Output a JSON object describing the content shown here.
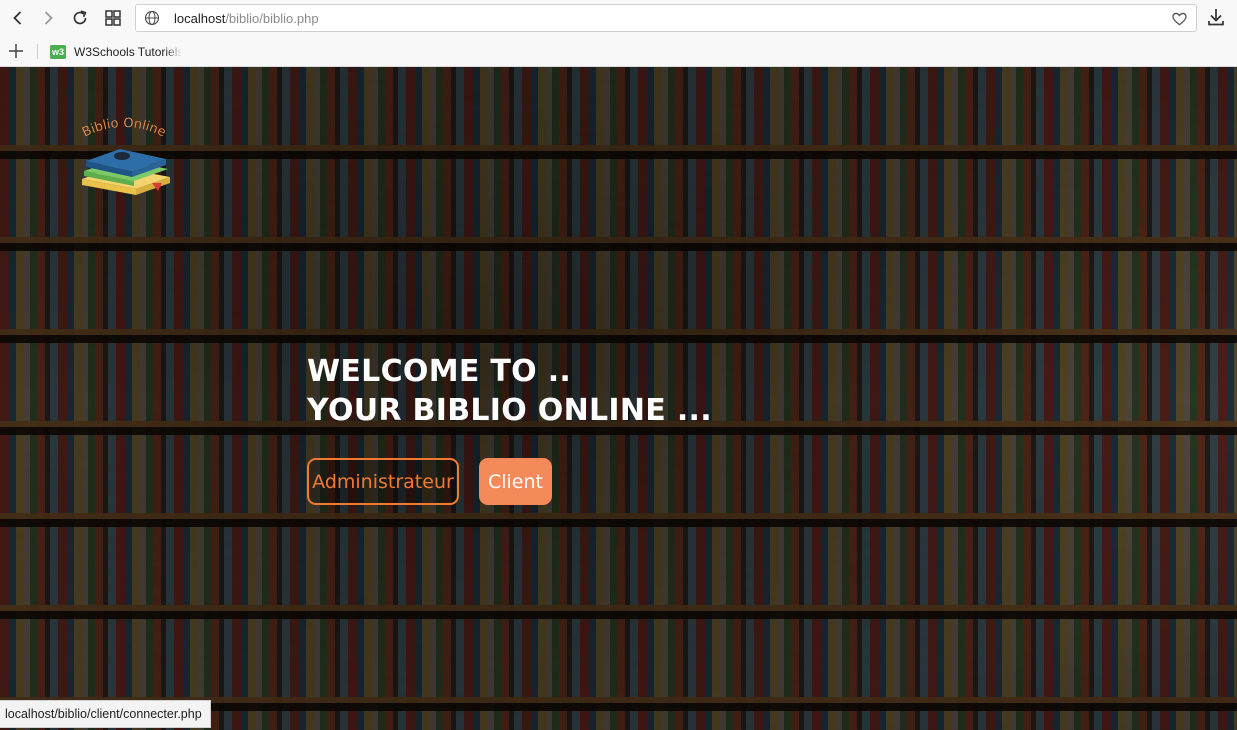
{
  "browser": {
    "url_host": "localhost",
    "url_path": "/biblio/biblio.php",
    "bookmarks": [
      {
        "label": "W3Schools Tutoriels",
        "favicon_text": "w3",
        "icon": "w3schools-favicon"
      }
    ],
    "status_url": "localhost/biblio/client/connecter.php"
  },
  "logo": {
    "text": "Biblio Online",
    "icon": "stack-of-books-logo"
  },
  "hero": {
    "line1": "WELCOME TO ..",
    "line2": "YOUR BIBLIO ONLINE ..."
  },
  "buttons": {
    "admin_label": "Administrateur",
    "client_label": "Client"
  },
  "colors": {
    "accent_orange": "#f07a32",
    "client_button_bg": "#f4895a",
    "heading_text": "#ffffff"
  }
}
